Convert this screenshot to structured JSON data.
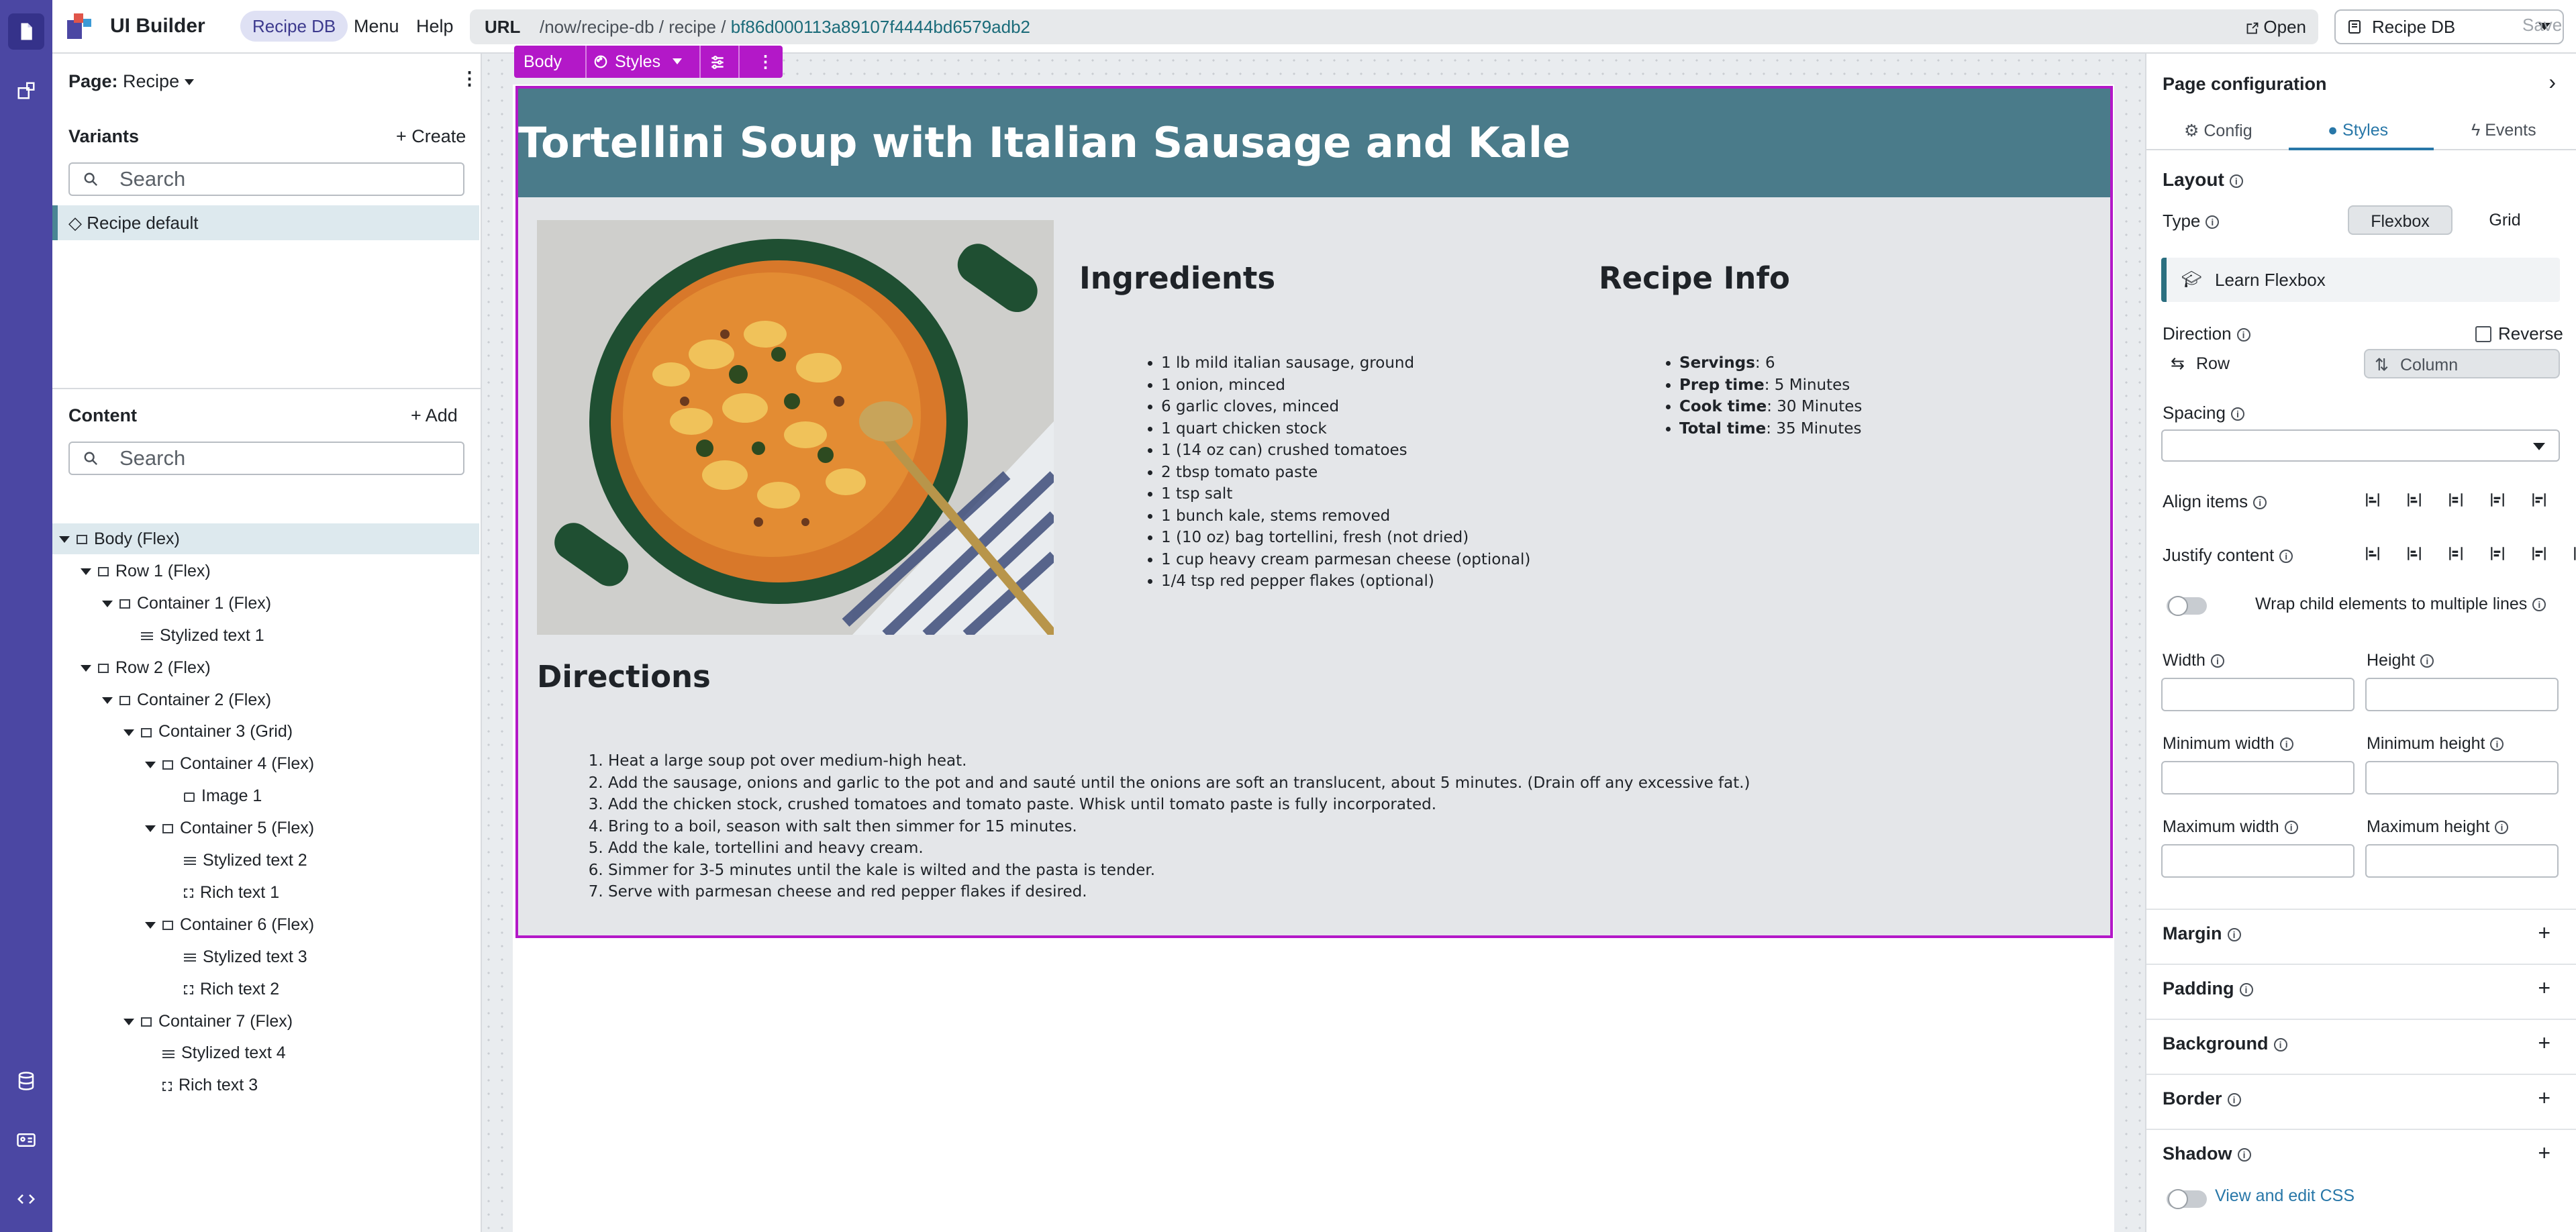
{
  "app": {
    "title": "UI Builder",
    "app_tag": "Recipe DB",
    "menu": "Menu",
    "help": "Help"
  },
  "url": {
    "label": "URL",
    "path": "/now/recipe-db / recipe / ",
    "hash": "bf86d000113a89107f4444bd6579adb2",
    "open": "Open"
  },
  "app_select": "Recipe DB",
  "save": "Save",
  "left_panel": {
    "page_label": "Page:",
    "page_value": "Recipe",
    "variants_title": "Variants",
    "create": "+ Create",
    "search_placeholder": "Search",
    "variant": "Recipe default",
    "content_title": "Content",
    "add": "+ Add",
    "tree": [
      {
        "label": "Body (Flex)",
        "depth": 0,
        "icon": "body-icon",
        "expand": true
      },
      {
        "label": "Row 1 (Flex)",
        "depth": 1,
        "icon": "box-icon",
        "expand": true
      },
      {
        "label": "Container 1 (Flex)",
        "depth": 2,
        "icon": "box-icon",
        "expand": true
      },
      {
        "label": "Stylized text 1",
        "depth": 3,
        "icon": "text-icon",
        "expand": false
      },
      {
        "label": "Row 2 (Flex)",
        "depth": 1,
        "icon": "box-icon",
        "expand": true
      },
      {
        "label": "Container 2 (Flex)",
        "depth": 2,
        "icon": "box-icon",
        "expand": true
      },
      {
        "label": "Container 3 (Grid)",
        "depth": 3,
        "icon": "box-icon",
        "expand": true
      },
      {
        "label": "Container 4 (Flex)",
        "depth": 4,
        "icon": "box-icon",
        "expand": true
      },
      {
        "label": "Image 1",
        "depth": 5,
        "icon": "image-icon",
        "expand": false
      },
      {
        "label": "Container 5 (Flex)",
        "depth": 4,
        "icon": "box-icon",
        "expand": true
      },
      {
        "label": "Stylized text 2",
        "depth": 5,
        "icon": "text-icon",
        "expand": false
      },
      {
        "label": "Rich text 1",
        "depth": 5,
        "icon": "rich-text-icon",
        "expand": false
      },
      {
        "label": "Container 6 (Flex)",
        "depth": 4,
        "icon": "box-icon",
        "expand": true
      },
      {
        "label": "Stylized text 3",
        "depth": 5,
        "icon": "text-icon",
        "expand": false
      },
      {
        "label": "Rich text 2",
        "depth": 5,
        "icon": "rich-text-icon",
        "expand": false
      },
      {
        "label": "Container 7 (Flex)",
        "depth": 3,
        "icon": "box-icon",
        "expand": true
      },
      {
        "label": "Stylized text 4",
        "depth": 4,
        "icon": "text-icon",
        "expand": false
      },
      {
        "label": "Rich text 3",
        "depth": 4,
        "icon": "rich-text-icon",
        "expand": false
      }
    ]
  },
  "canvas_toolbar": {
    "element": "Body",
    "styles": "Styles"
  },
  "recipe": {
    "title": "Tortellini Soup with Italian Sausage and Kale",
    "ingredients_title": "Ingredients",
    "ingredients": [
      "1 lb mild italian sausage, ground",
      "1 onion, minced",
      "6 garlic cloves, minced",
      "1 quart chicken stock",
      "1 (14 oz can) crushed tomatoes",
      "2 tbsp tomato paste",
      "1 tsp salt",
      "1 bunch kale, stems removed",
      "1 (10 oz) bag tortellini, fresh (not dried)",
      "1 cup heavy cream parmesan cheese (optional)",
      "1/4 tsp red pepper flakes (optional)"
    ],
    "info_title": "Recipe Info",
    "info": [
      {
        "label": "Servings",
        "value": ": 6"
      },
      {
        "label": "Prep time",
        "value": ": 5 Minutes"
      },
      {
        "label": "Cook time",
        "value": ": 30 Minutes"
      },
      {
        "label": "Total time",
        "value": ": 35 Minutes"
      }
    ],
    "directions_title": "Directions",
    "directions": [
      "Heat a large soup pot over medium-high heat.",
      "Add the sausage, onions and garlic to the pot and and sauté until the onions are soft an translucent, about 5 minutes. (Drain off any excessive fat.)",
      "Add the chicken stock, crushed tomatoes and tomato paste. Whisk until tomato paste is fully incorporated.",
      "Bring to a boil, season with salt then simmer for 15 minutes.",
      "Add the kale, tortellini and heavy cream.",
      "Simmer for 3-5 minutes until the kale is wilted and the pasta is tender.",
      "Serve with parmesan cheese and red pepper flakes if desired."
    ]
  },
  "right_panel": {
    "title": "Page configuration",
    "tabs": [
      "Config",
      "Styles",
      "Events"
    ],
    "active_tab": "Styles",
    "layout": "Layout",
    "type": "Type",
    "type_options": [
      "Flexbox",
      "Grid"
    ],
    "learn": "Learn Flexbox",
    "direction": "Direction",
    "reverse": "Reverse",
    "row": "Row",
    "column": "Column",
    "spacing": "Spacing",
    "align_items": "Align items",
    "justify_content": "Justify content",
    "wrap": "Wrap child elements to multiple lines",
    "width": "Width",
    "height": "Height",
    "min_width": "Minimum width",
    "min_height": "Minimum height",
    "max_width": "Maximum width",
    "max_height": "Maximum height",
    "sections": [
      "Margin",
      "Padding",
      "Background",
      "Border",
      "Shadow"
    ],
    "view_css": "View and edit CSS"
  },
  "colors": {
    "rail": "#4b47a3",
    "accent": "#b318c8",
    "header": "#4a7b8a",
    "link": "#2877a8"
  }
}
